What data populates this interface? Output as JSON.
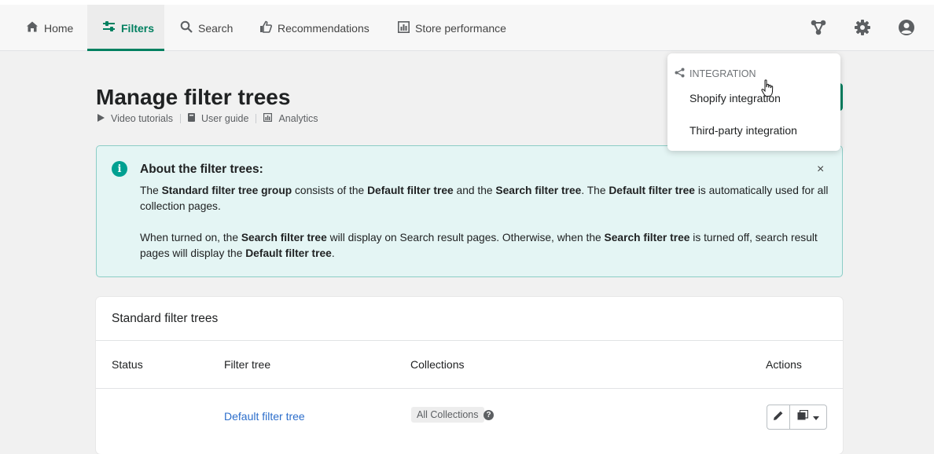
{
  "nav": {
    "tabs": [
      {
        "label": "Home",
        "icon": "home-icon"
      },
      {
        "label": "Filters",
        "icon": "filters-icon",
        "active": true
      },
      {
        "label": "Search",
        "icon": "search-icon"
      },
      {
        "label": "Recommendations",
        "icon": "thumbs-up-icon"
      },
      {
        "label": "Store performance",
        "icon": "bar-chart-icon"
      }
    ],
    "right_icons": [
      "integration-icon",
      "gear-icon",
      "account-icon"
    ]
  },
  "page": {
    "title": "Manage filter trees",
    "links": [
      {
        "label": "Video tutorials",
        "icon": "play-icon"
      },
      {
        "label": "User guide",
        "icon": "book-icon"
      },
      {
        "label": "Analytics",
        "icon": "analytics-icon"
      }
    ]
  },
  "dropdown": {
    "header": "INTEGRATION",
    "items": [
      "Shopify integration",
      "Third-party integration"
    ]
  },
  "banner": {
    "title": "About the filter trees:",
    "close": "×",
    "p1": {
      "t1": "The ",
      "b1": "Standard filter tree group",
      "t2": " consists of the ",
      "b2": "Default filter tree",
      "t3": " and the ",
      "b3": "Search filter tree",
      "t4": ". The ",
      "b4": "Default filter tree",
      "t5": " is automatically used for all collection pages."
    },
    "p2": {
      "t1": "When turned on, the ",
      "b1": "Search filter tree",
      "t2": " will display on Search result pages. Otherwise, when the ",
      "b2": "Search filter tree",
      "t3": " is turned off, search result pages will display the ",
      "b3": "Default filter tree",
      "t4": "."
    }
  },
  "card": {
    "title": "Standard filter trees",
    "headers": {
      "status": "Status",
      "filter_tree": "Filter tree",
      "collections": "Collections",
      "actions": "Actions"
    },
    "rows": [
      {
        "filter_tree": "Default filter tree",
        "collections": "All Collections",
        "help": "?"
      }
    ]
  },
  "colors": {
    "accent": "#008060",
    "link": "#2c6ecb",
    "banner_bg": "#e4f5f4",
    "banner_border": "#8ccdc6"
  }
}
